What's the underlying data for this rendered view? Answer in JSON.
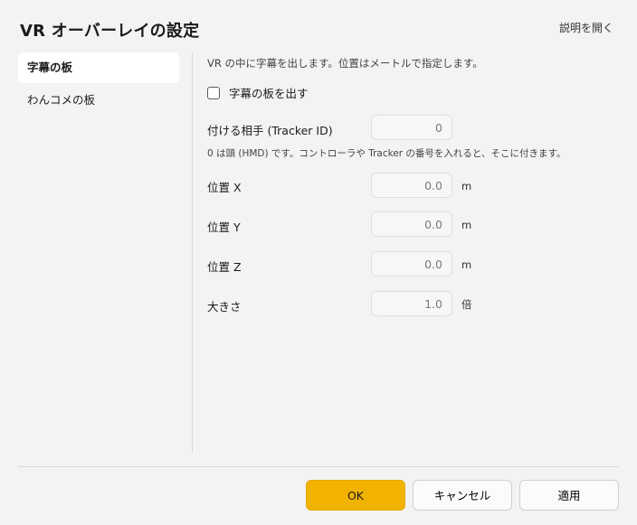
{
  "window": {
    "title": "VR オーバーレイの設定",
    "help_link": "説明を開く"
  },
  "sidebar": {
    "items": [
      {
        "label": "字幕の板",
        "active": true
      },
      {
        "label": "わんコメの板",
        "active": false
      }
    ]
  },
  "content": {
    "description": "VR の中に字幕を出します。位置はメートルで指定します。",
    "show_board": {
      "label": "字幕の板を出す",
      "checked": false
    },
    "tracker": {
      "label": "付ける相手 (Tracker ID)",
      "value": "0"
    },
    "tracker_note": "0 は頭 (HMD) です。コントローラや Tracker の番号を入れると、そこに付きます。",
    "pos_x": {
      "label": "位置 X",
      "value": "0.0",
      "unit": "m"
    },
    "pos_y": {
      "label": "位置 Y",
      "value": "0.0",
      "unit": "m"
    },
    "pos_z": {
      "label": "位置 Z",
      "value": "0.0",
      "unit": "m"
    },
    "size": {
      "label": "大きさ",
      "value": "1.0",
      "unit": "倍"
    }
  },
  "footer": {
    "ok_label": "OK",
    "cancel_label": "キャンセル",
    "apply_label": "適用"
  },
  "colors": {
    "accent": "#f2b300",
    "background": "#f3f3f3"
  }
}
